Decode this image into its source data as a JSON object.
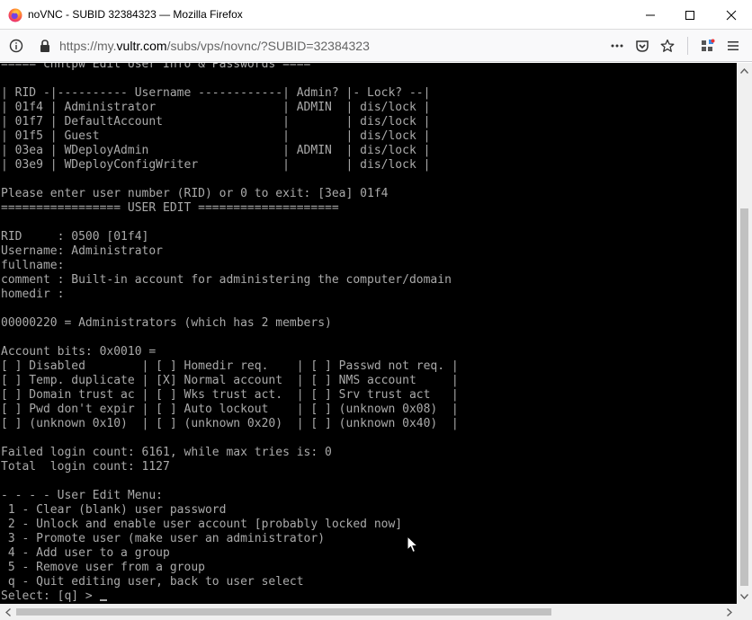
{
  "window": {
    "title": "noVNC - SUBID 32384323 — Mozilla Firefox"
  },
  "navbar": {
    "url_prefix": "https://my.",
    "url_domain": "vultr.com",
    "url_path": "/subs/vps/novnc/?SUBID=32384323"
  },
  "icons": {
    "app": "firefox-icon",
    "info": "info-icon",
    "lock": "lock-icon",
    "more": "more-icon",
    "pocket": "pocket-icon",
    "bookmark": "star-icon",
    "extensions": "extensions-icon",
    "menu": "hamburger-menu-icon"
  },
  "terminal": {
    "lines": [
      "===== chntpw Edit User Info & Passwords ====",
      "",
      "| RID -|---------- Username ------------| Admin? |- Lock? --|",
      "| 01f4 | Administrator                  | ADMIN  | dis/lock |",
      "| 01f7 | DefaultAccount                 |        | dis/lock |",
      "| 01f5 | Guest                          |        | dis/lock |",
      "| 03ea | WDeployAdmin                   | ADMIN  | dis/lock |",
      "| 03e9 | WDeployConfigWriter            |        | dis/lock |",
      "",
      "Please enter user number (RID) or 0 to exit: [3ea] 01f4",
      "================= USER EDIT ====================",
      "",
      "RID     : 0500 [01f4]",
      "Username: Administrator",
      "fullname:",
      "comment : Built-in account for administering the computer/domain",
      "homedir :",
      "",
      "00000220 = Administrators (which has 2 members)",
      "",
      "Account bits: 0x0010 =",
      "[ ] Disabled        | [ ] Homedir req.    | [ ] Passwd not req. |",
      "[ ] Temp. duplicate | [X] Normal account  | [ ] NMS account     |",
      "[ ] Domain trust ac | [ ] Wks trust act.  | [ ] Srv trust act   |",
      "[ ] Pwd don't expir | [ ] Auto lockout    | [ ] (unknown 0x08)  |",
      "[ ] (unknown 0x10)  | [ ] (unknown 0x20)  | [ ] (unknown 0x40)  |",
      "",
      "Failed login count: 6161, while max tries is: 0",
      "Total  login count: 1127",
      "",
      "- - - - User Edit Menu:",
      " 1 - Clear (blank) user password",
      " 2 - Unlock and enable user account [probably locked now]",
      " 3 - Promote user (make user an administrator)",
      " 4 - Add user to a group",
      " 5 - Remove user from a group",
      " q - Quit editing user, back to user select"
    ],
    "prompt": "Select: [q] > "
  }
}
